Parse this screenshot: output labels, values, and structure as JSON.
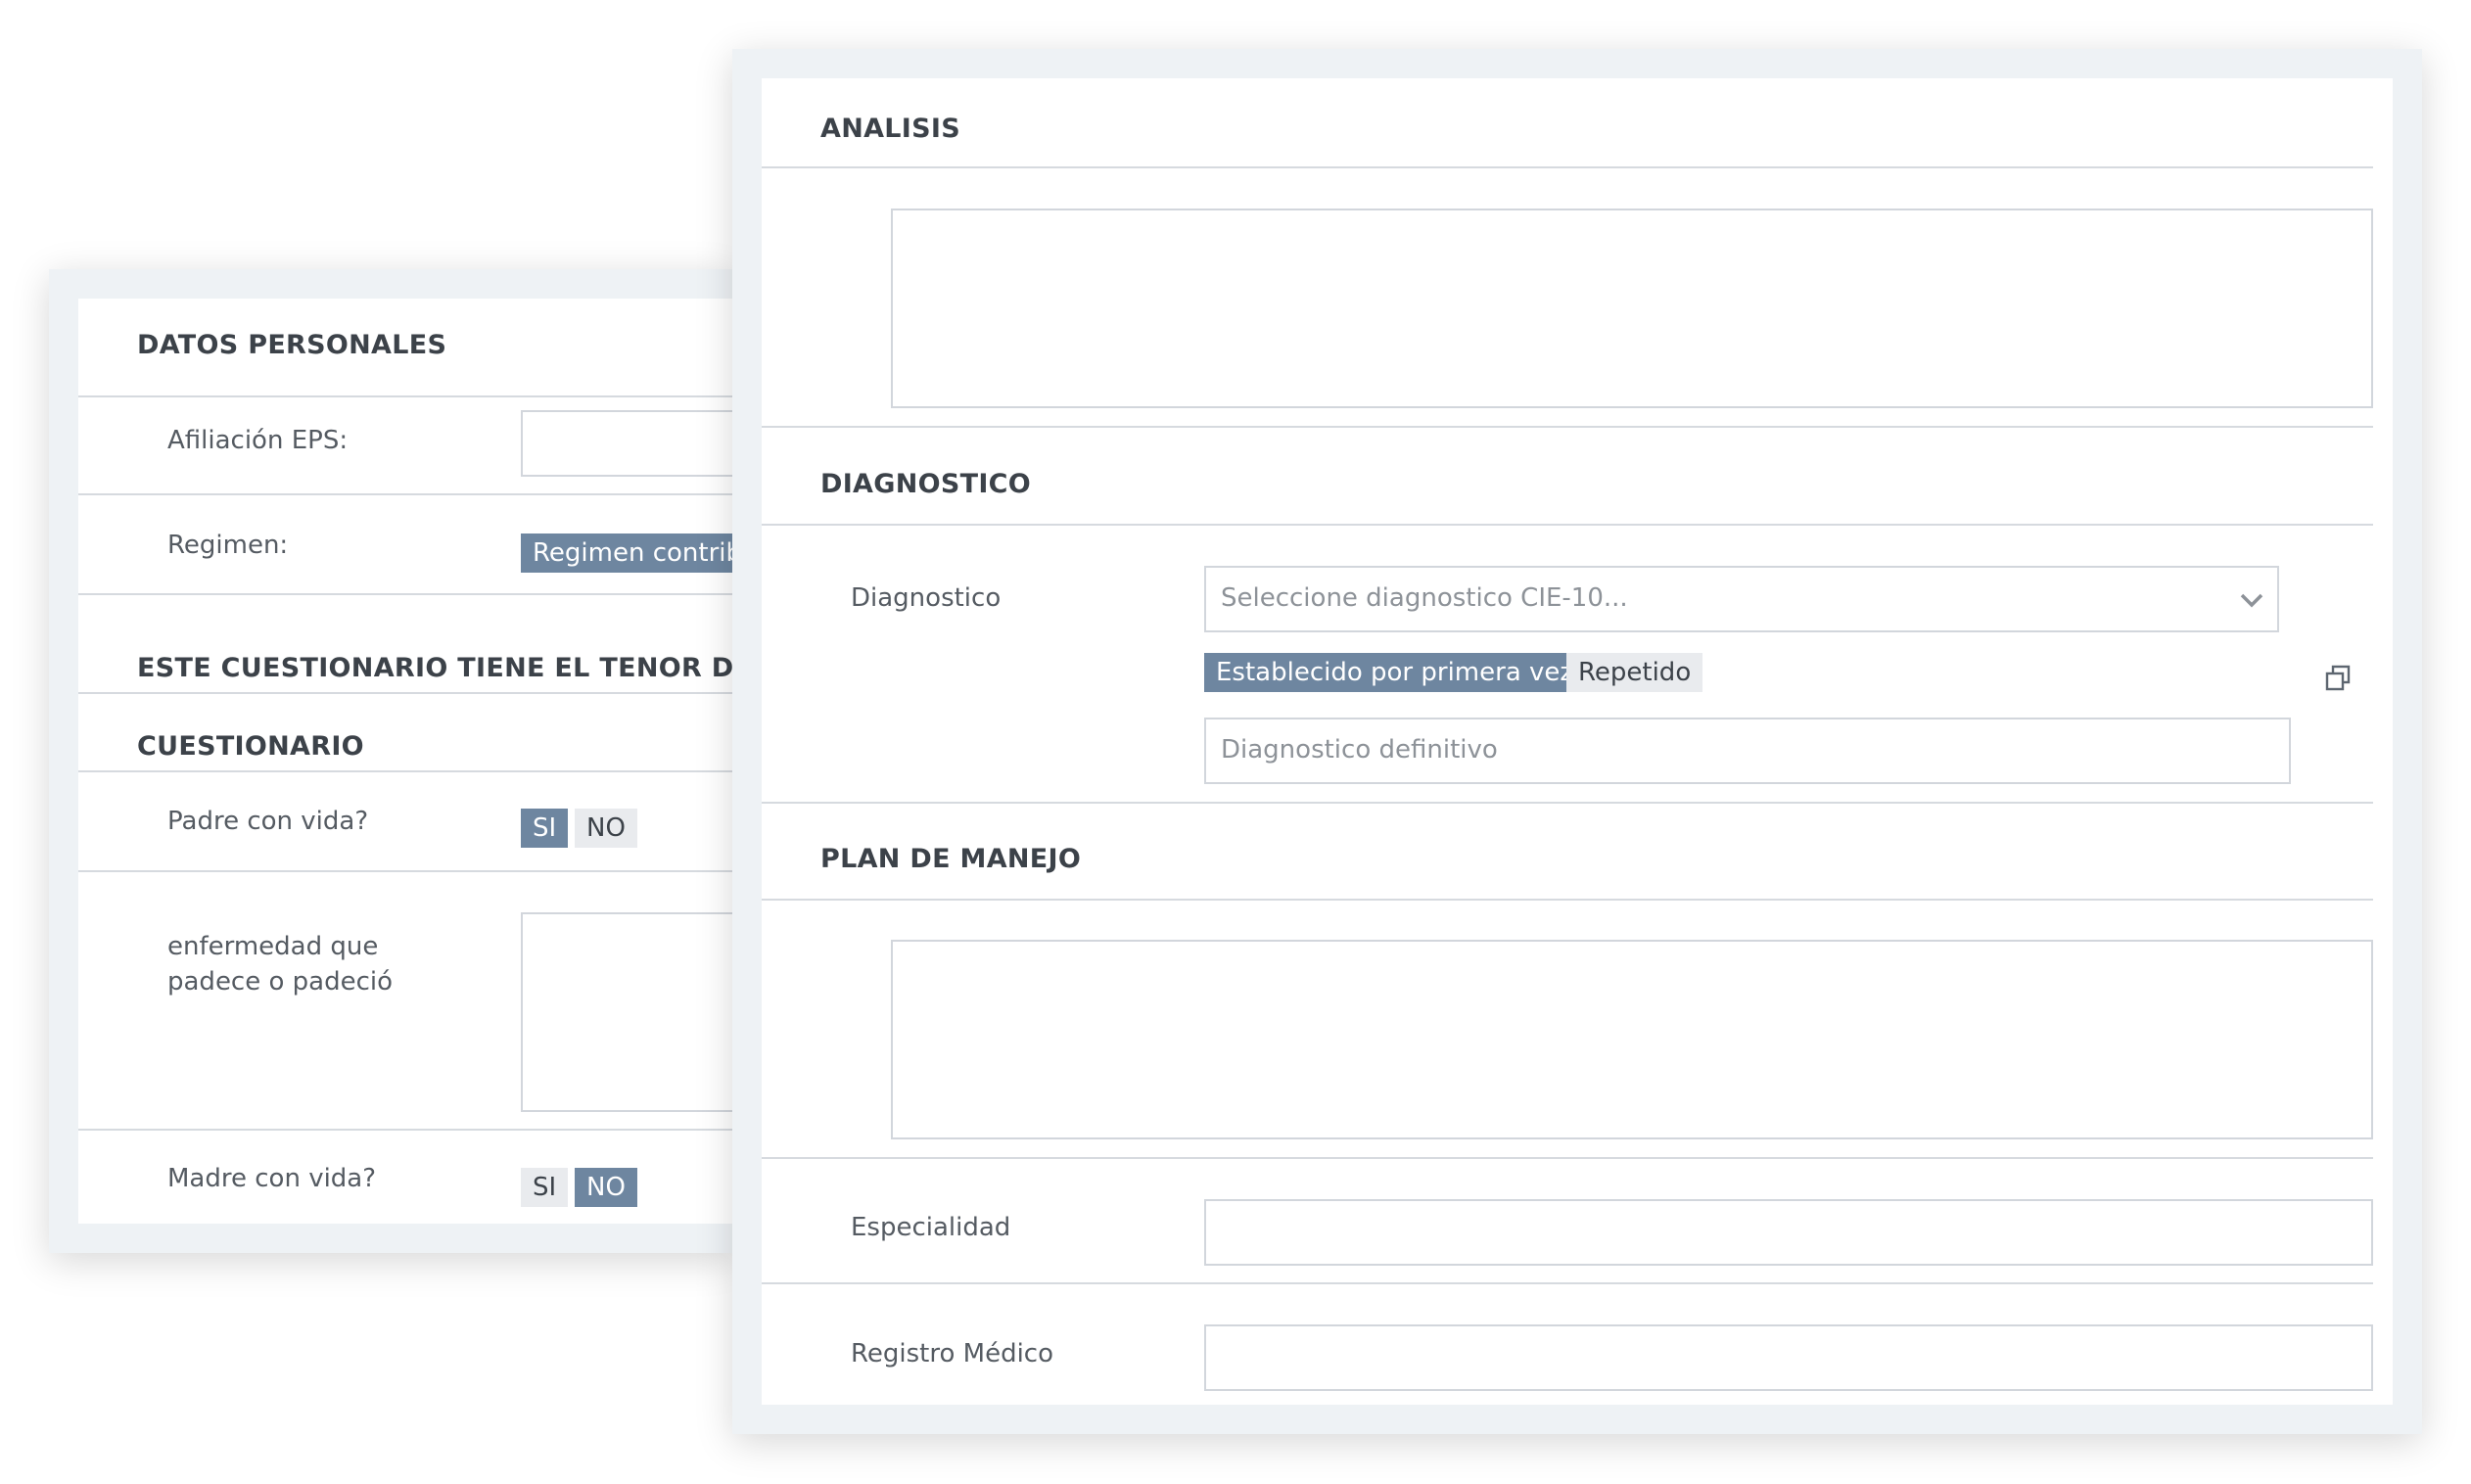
{
  "colors": {
    "accent": "#6e86a0",
    "panel_frame": "#eef2f5",
    "border": "#d2d6dc",
    "divider": "#d6dadf",
    "inactive_tag": "#e9ebee"
  },
  "back_panel": {
    "datos_personales": {
      "title": "DATOS PERSONALES",
      "afiliacion_label": "Afiliación EPS:",
      "afiliacion_value": "",
      "regimen_label": "Regimen:",
      "regimen_selected": "Regimen contrib"
    },
    "notice_title": "ESTE CUESTIONARIO TIENE EL TENOR DE UN",
    "cuestionario": {
      "title": "CUESTIONARIO",
      "padre_label": "Padre con vida?",
      "padre_options": [
        "SI",
        "NO"
      ],
      "padre_selected": "SI",
      "enfermedad_label": "enfermedad que padece o padeció",
      "enfermedad_value": "",
      "madre_label": "Madre con vida?",
      "madre_options": [
        "SI",
        "NO"
      ],
      "madre_selected": "NO"
    }
  },
  "front_panel": {
    "analisis": {
      "title": "ANALISIS",
      "value": ""
    },
    "diagnostico": {
      "title": "DIAGNOSTICO",
      "label": "Diagnostico",
      "select_placeholder": "Seleccione diagnostico CIE-10...",
      "status_options": [
        "Establecido por primera vez",
        "Repetido"
      ],
      "status_selected": "Establecido por primera vez",
      "definitivo_placeholder": "Diagnostico definitivo",
      "icons": {
        "dropdown": "chevron-down-icon",
        "popout": "popout-window-icon"
      }
    },
    "plan_de_manejo": {
      "title": "PLAN DE MANEJO",
      "value": ""
    },
    "especialidad": {
      "label": "Especialidad",
      "value": ""
    },
    "registro_medico": {
      "label": "Registro Médico",
      "value": ""
    }
  }
}
